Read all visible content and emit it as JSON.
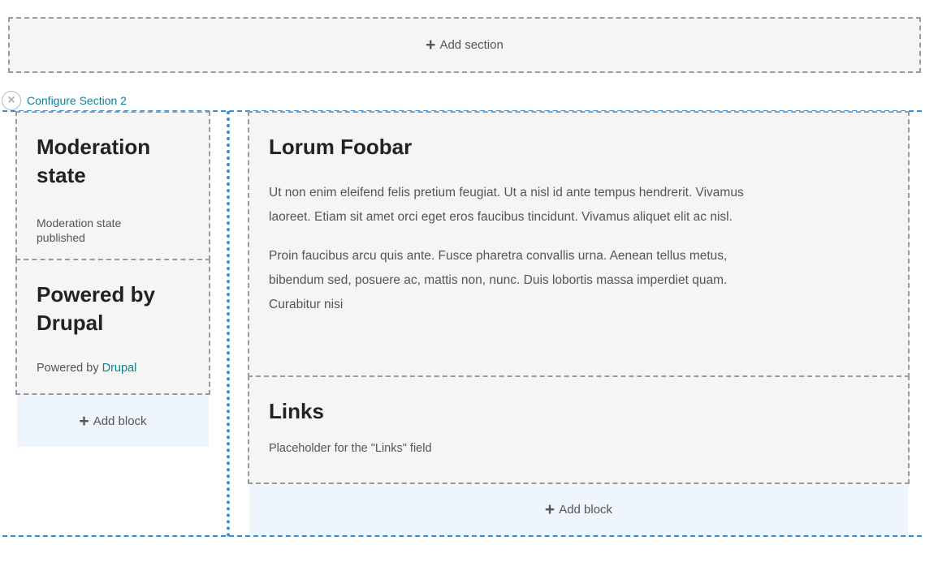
{
  "add_section": {
    "icon": "+",
    "label": "Add section"
  },
  "section": {
    "close_icon": "×",
    "configure_label": "Configure Section 2",
    "first_region": {
      "blocks": [
        {
          "title": "Moderation state",
          "label": "Moderation state",
          "value": "published"
        },
        {
          "title": "Powered by Drupal",
          "text": "Powered by ",
          "link": "Drupal"
        }
      ],
      "add_block": {
        "icon": "+",
        "label": "Add block"
      }
    },
    "second_region": {
      "blocks": [
        {
          "title": "Lorum Foobar",
          "paragraphs": [
            "Ut non enim eleifend felis pretium feugiat. Ut a nisl id ante tempus hendrerit. Vivamus laoreet. Etiam sit amet orci eget eros faucibus tincidunt. Vivamus aliquet elit ac nisl.",
            "Proin faucibus arcu quis ante. Fusce pharetra convallis urna. Aenean tellus metus, bibendum sed, posuere ac, mattis non, nunc. Duis lobortis massa imperdiet quam. Curabitur nisi"
          ]
        },
        {
          "title": "Links",
          "text": "Placeholder for the \"Links\" field"
        }
      ],
      "add_block": {
        "icon": "+",
        "label": "Add block"
      }
    }
  }
}
